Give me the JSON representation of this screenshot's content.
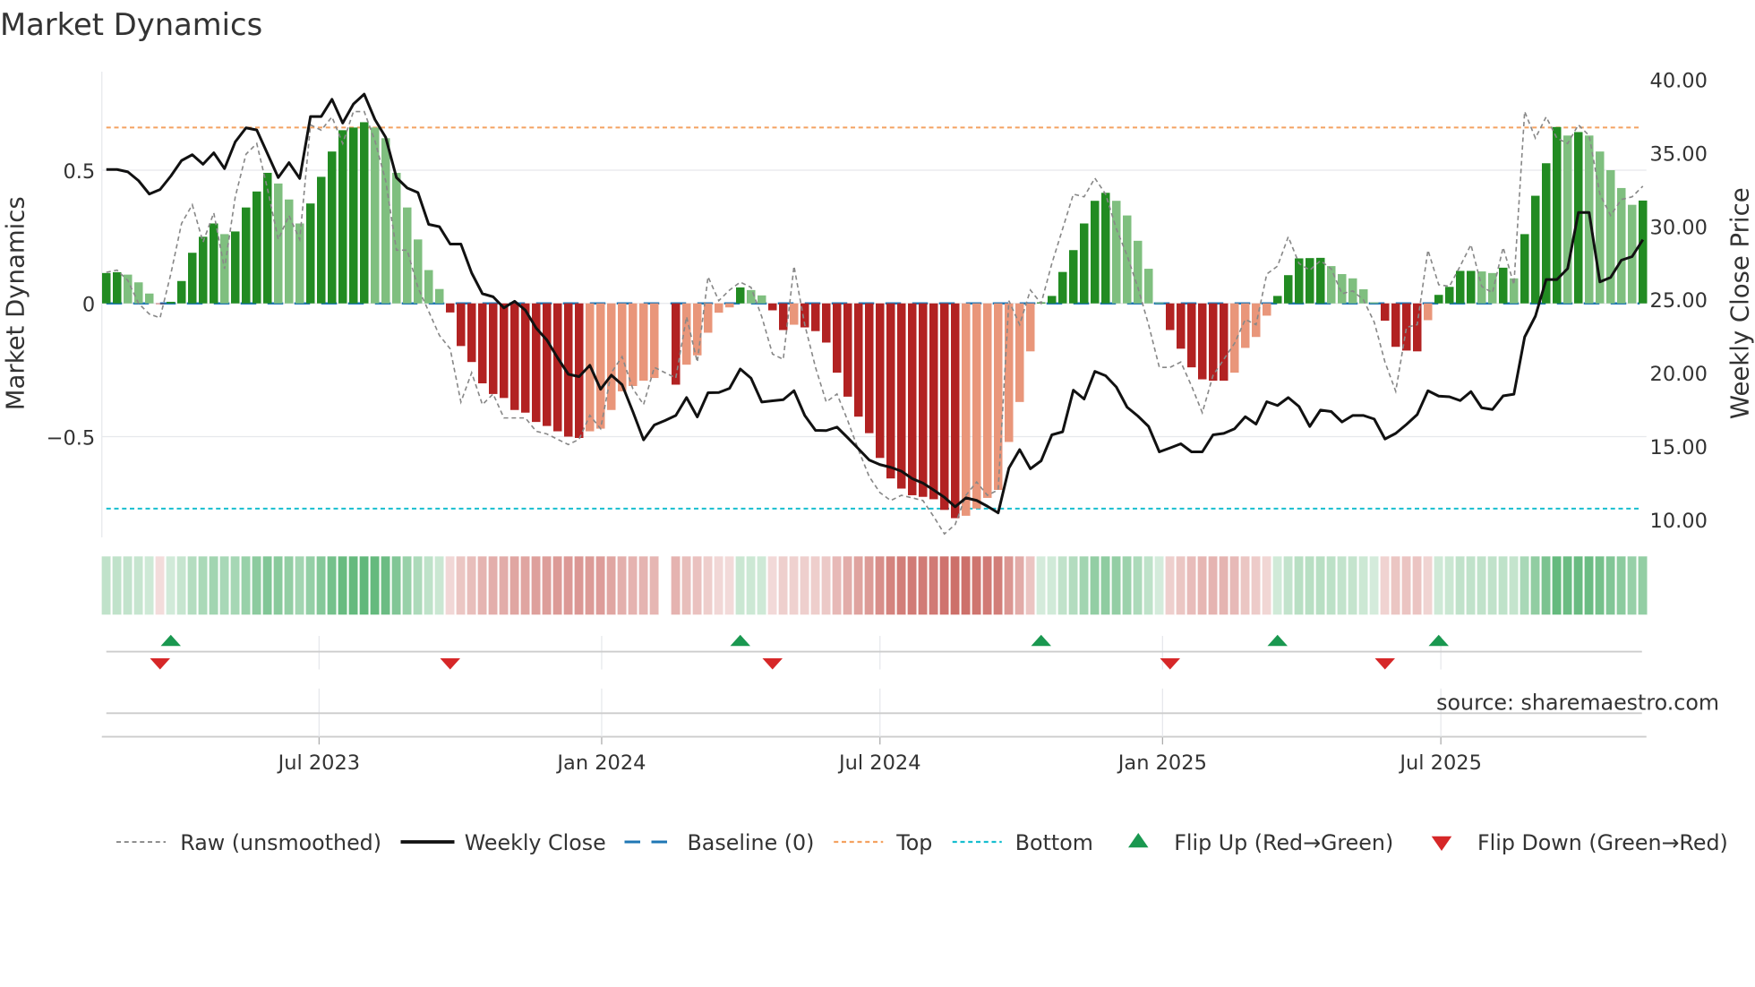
{
  "title": "Market Dynamics",
  "source": "source: sharemaestro.com",
  "colors": {
    "green_dark": "#228b22",
    "green_light": "#7fbf7f",
    "red_dark": "#b22222",
    "red_light": "#e9967a",
    "close": "#111111",
    "raw": "#888888",
    "baseline": "#1f77b4",
    "top": "#f4a261",
    "bottom": "#17becf",
    "flip_up": "#1a9850",
    "flip_down": "#d62728",
    "strip_green": "#3aa65a",
    "strip_red": "#c8605a"
  },
  "chart_data": {
    "type": "bar",
    "title": "Market Dynamics",
    "frequency": "weekly",
    "ylabel": "Market Dynamics",
    "y2label": "Weekly Close Price",
    "ylim": [
      -0.87,
      0.87
    ],
    "y2lim": [
      8.8,
      41.3
    ],
    "yticks": [
      {
        "value": 0.5,
        "label": "0.5"
      },
      {
        "value": 0,
        "label": "0"
      },
      {
        "value": -0.5,
        "label": "−0.5"
      }
    ],
    "y2ticks": [
      {
        "value": 40,
        "label": "40.00"
      },
      {
        "value": 35,
        "label": "35.00"
      },
      {
        "value": 30,
        "label": "30.00"
      },
      {
        "value": 25,
        "label": "25.00"
      },
      {
        "value": 20,
        "label": "20.00"
      },
      {
        "value": 15,
        "label": "15.00"
      },
      {
        "value": 10,
        "label": "10.00"
      }
    ],
    "xticks": [
      {
        "week": 19.8,
        "label": "Jul 2023"
      },
      {
        "week": 46.1,
        "label": "Jan 2024"
      },
      {
        "week": 72.0,
        "label": "Jul 2024"
      },
      {
        "week": 98.3,
        "label": "Jan 2025"
      },
      {
        "week": 124.2,
        "label": "Jul 2025"
      }
    ],
    "top": 0.66,
    "bottom": -0.77,
    "baseline": 0,
    "momentum": [
      0.114,
      0.117,
      0.108,
      0.079,
      0.037,
      -0.002,
      0.006,
      0.084,
      0.19,
      0.25,
      0.3,
      0.26,
      0.27,
      0.36,
      0.42,
      0.49,
      0.45,
      0.39,
      0.3,
      0.375,
      0.475,
      0.57,
      0.65,
      0.66,
      0.68,
      0.66,
      0.62,
      0.49,
      0.36,
      0.24,
      0.125,
      0.054,
      -0.034,
      -0.16,
      -0.22,
      -0.3,
      -0.34,
      -0.355,
      -0.4,
      -0.41,
      -0.445,
      -0.46,
      -0.48,
      -0.5,
      -0.505,
      -0.48,
      -0.47,
      -0.4,
      -0.33,
      -0.31,
      -0.29,
      -0.28,
      null,
      -0.305,
      -0.23,
      -0.195,
      -0.11,
      -0.035,
      -0.015,
      0.06,
      0.05,
      0.03,
      -0.026,
      -0.1,
      -0.08,
      -0.09,
      -0.104,
      -0.147,
      -0.26,
      -0.35,
      -0.425,
      -0.487,
      -0.58,
      -0.657,
      -0.695,
      -0.72,
      -0.726,
      -0.735,
      -0.775,
      -0.806,
      -0.797,
      -0.77,
      -0.73,
      -0.7,
      -0.52,
      -0.37,
      -0.18,
      0.004,
      0.028,
      0.118,
      0.2,
      0.3,
      0.385,
      0.415,
      0.385,
      0.33,
      0.235,
      0.13,
      0.003,
      -0.1,
      -0.17,
      -0.24,
      -0.285,
      -0.29,
      -0.29,
      -0.26,
      -0.167,
      -0.126,
      -0.046,
      0.028,
      0.106,
      0.169,
      0.17,
      0.171,
      0.14,
      0.11,
      0.094,
      0.053,
      0.004,
      -0.065,
      -0.163,
      -0.177,
      -0.18,
      -0.063,
      0.032,
      0.062,
      0.122,
      0.122,
      0.12,
      0.114,
      0.134,
      0.094,
      0.26,
      0.404,
      0.526,
      0.662,
      0.63,
      0.643,
      0.63,
      0.57,
      0.5,
      0.433,
      0.37,
      0.386
    ],
    "raw": [
      0.117,
      0.125,
      0.086,
      0.0,
      -0.04,
      -0.054,
      0.11,
      0.3,
      0.37,
      0.23,
      0.34,
      0.13,
      0.4,
      0.56,
      0.6,
      0.43,
      0.24,
      0.33,
      0.24,
      0.67,
      0.65,
      0.7,
      0.6,
      0.72,
      0.72,
      0.61,
      0.46,
      0.2,
      0.2,
      0.06,
      -0.03,
      -0.12,
      -0.17,
      -0.37,
      -0.26,
      -0.38,
      -0.34,
      -0.43,
      -0.43,
      -0.43,
      -0.48,
      -0.49,
      -0.51,
      -0.53,
      -0.51,
      -0.42,
      -0.47,
      -0.26,
      -0.2,
      -0.32,
      -0.38,
      -0.24,
      -0.26,
      -0.28,
      -0.05,
      -0.22,
      0.1,
      0.01,
      0.05,
      0.08,
      0.06,
      -0.05,
      -0.19,
      -0.21,
      0.14,
      -0.08,
      -0.24,
      -0.37,
      -0.34,
      -0.44,
      -0.55,
      -0.65,
      -0.71,
      -0.74,
      -0.72,
      -0.73,
      -0.74,
      -0.8,
      -0.865,
      -0.83,
      -0.72,
      -0.67,
      -0.72,
      -0.7,
      0.01,
      -0.08,
      0.05,
      0.0,
      0.15,
      0.28,
      0.41,
      0.4,
      0.47,
      0.41,
      0.28,
      0.18,
      0.06,
      -0.08,
      -0.24,
      -0.24,
      -0.22,
      -0.31,
      -0.41,
      -0.27,
      -0.21,
      -0.15,
      -0.06,
      -0.08,
      0.11,
      0.14,
      0.25,
      0.15,
      0.125,
      0.16,
      0.13,
      0.036,
      0.047,
      0.013,
      -0.07,
      -0.22,
      -0.33,
      -0.09,
      -0.08,
      0.2,
      0.07,
      0.064,
      0.14,
      0.22,
      0.064,
      0.04,
      0.21,
      0.07,
      0.72,
      0.62,
      0.7,
      0.62,
      0.6,
      0.67,
      0.63,
      0.41,
      0.33,
      0.39,
      0.4,
      0.44
    ],
    "close": [
      33.86,
      33.86,
      33.7,
      33.1,
      32.19,
      32.5,
      33.41,
      34.47,
      34.87,
      34.22,
      35.0,
      33.92,
      35.75,
      36.7,
      36.56,
      34.94,
      33.31,
      34.33,
      33.25,
      37.47,
      37.47,
      38.65,
      37.03,
      38.33,
      39.0,
      37.27,
      36.05,
      33.31,
      32.6,
      32.29,
      30.12,
      29.96,
      28.78,
      28.78,
      26.81,
      25.4,
      25.18,
      24.43,
      24.88,
      24.27,
      23.05,
      22.24,
      21.02,
      19.9,
      19.74,
      20.51,
      18.88,
      19.84,
      19.19,
      17.36,
      15.43,
      16.44,
      16.75,
      17.09,
      18.31,
      16.99,
      18.64,
      18.66,
      18.94,
      20.26,
      19.63,
      18.01,
      18.09,
      18.17,
      18.78,
      17.09,
      16.08,
      16.06,
      16.3,
      15.57,
      14.82,
      14.05,
      13.74,
      13.56,
      13.29,
      12.79,
      12.48,
      12.01,
      11.51,
      10.86,
      11.47,
      11.3,
      10.9,
      10.45,
      13.5,
      14.76,
      13.46,
      14.0,
      15.77,
      15.98,
      18.82,
      18.21,
      20.1,
      19.8,
      19.03,
      17.66,
      17.05,
      16.34,
      14.61,
      14.88,
      15.16,
      14.61,
      14.61,
      15.77,
      15.87,
      16.18,
      17.01,
      16.5,
      18.03,
      17.77,
      18.31,
      17.7,
      16.34,
      17.46,
      17.36,
      16.65,
      17.09,
      17.09,
      16.85,
      15.49,
      15.87,
      16.48,
      17.15,
      18.78,
      18.41,
      18.37,
      18.11,
      18.72,
      17.62,
      17.5,
      18.43,
      18.54,
      22.44,
      23.86,
      26.36,
      26.36,
      27.11,
      30.93,
      30.93,
      26.2,
      26.5,
      27.68,
      27.92,
      29.08
    ],
    "flip_up_weeks": [
      6,
      59,
      87,
      109,
      124
    ],
    "flip_down_weeks": [
      5,
      32,
      62,
      99,
      119
    ],
    "legend_position": "bottom",
    "legend": [
      {
        "key": "raw",
        "label": "Raw (unsmoothed)"
      },
      {
        "key": "close",
        "label": "Weekly Close"
      },
      {
        "key": "baseline",
        "label": "Baseline (0)"
      },
      {
        "key": "top",
        "label": "Top"
      },
      {
        "key": "bottom",
        "label": "Bottom"
      },
      {
        "key": "flip_up",
        "label": "Flip Up (Red→Green)"
      },
      {
        "key": "flip_down",
        "label": "Flip Down (Green→Red)"
      }
    ]
  }
}
